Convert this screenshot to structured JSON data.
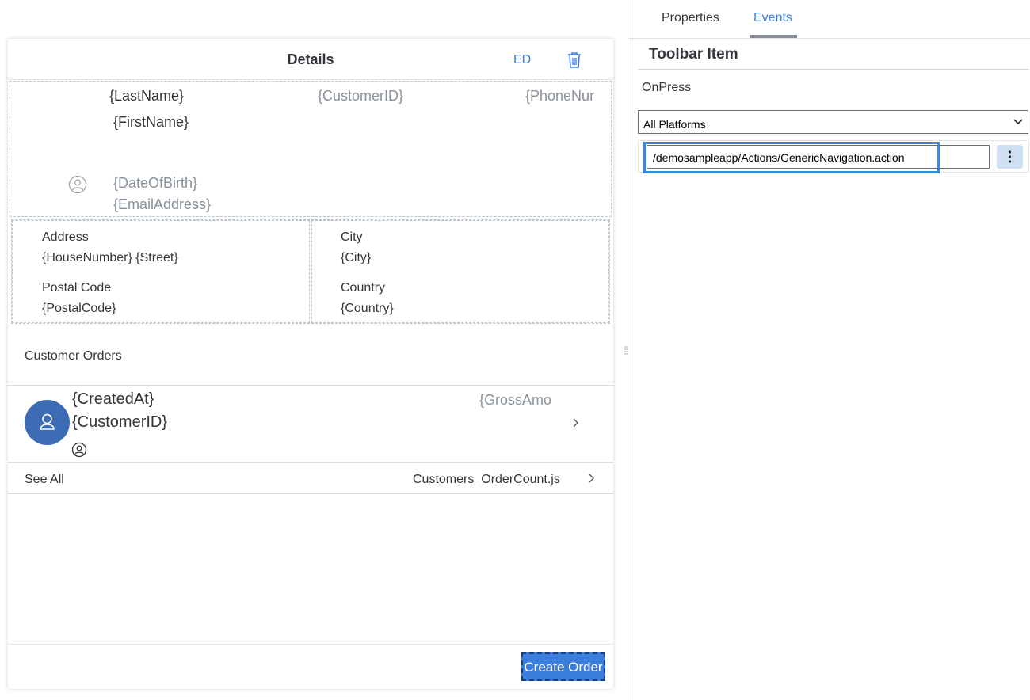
{
  "details_page": {
    "title": "Details",
    "edit_label": "ED",
    "profile": {
      "last_name": "{LastName}",
      "first_name": "{FirstName}",
      "customer_id": "{CustomerID}",
      "phone": "{PhoneNur",
      "date_of_birth": "{DateOfBirth}",
      "email": "{EmailAddress}"
    },
    "address": {
      "address_label": "Address",
      "address_value": "{HouseNumber} {Street}",
      "postal_label": "Postal Code",
      "postal_value": "{PostalCode}",
      "city_label": "City",
      "city_value": "{City}",
      "country_label": "Country",
      "country_value": "{Country}"
    },
    "orders": {
      "title": "Customer Orders",
      "item": {
        "created_at": "{CreatedAt}",
        "customer_id": "{CustomerID}",
        "gross_amount": "{GrossAmo"
      },
      "see_all_label": "See All",
      "see_all_value": "Customers_OrderCount.js"
    },
    "create_order_label": "Create Order"
  },
  "properties_panel": {
    "tabs": [
      {
        "label": "Properties",
        "active": false
      },
      {
        "label": "Events",
        "active": true
      }
    ],
    "section_title": "Toolbar Item",
    "event_name": "OnPress",
    "platform_select": "All Platforms",
    "action_value": "/demosampleapp/Actions/GenericNavigation.action"
  },
  "colors": {
    "accent": "#3b7ddd",
    "avatar": "#3d6cb4",
    "placeholder_text": "#89919a",
    "highlight": "#2f8be6"
  }
}
